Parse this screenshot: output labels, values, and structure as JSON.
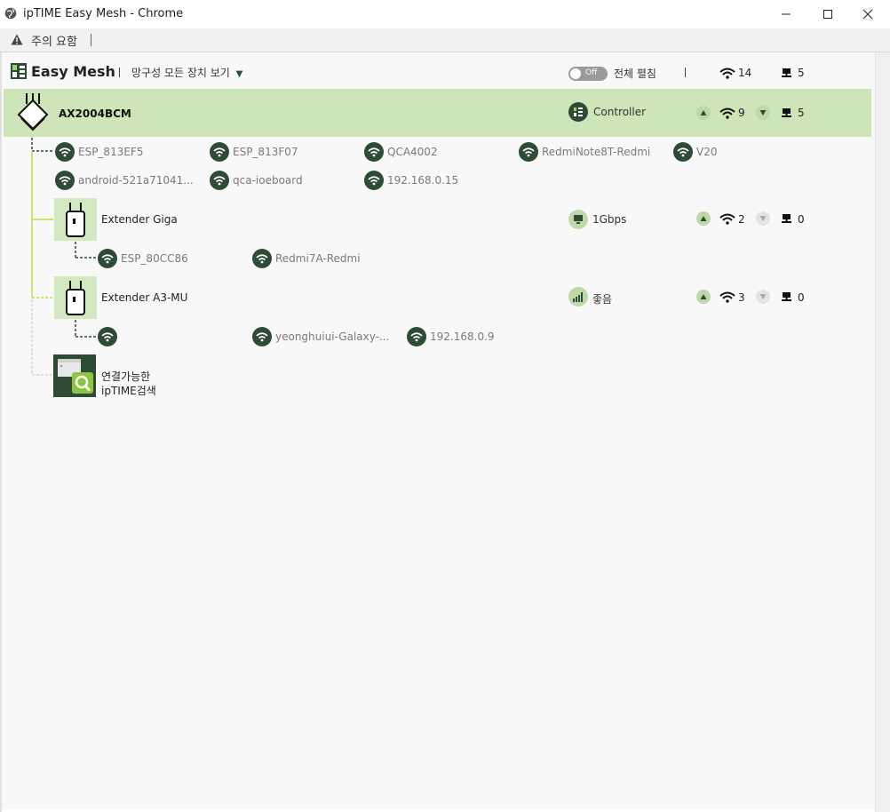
{
  "window": {
    "title": "ipTIME Easy Mesh - Chrome"
  },
  "addressbar": {
    "warning": "주의 요함"
  },
  "header": {
    "app_title": "Easy Mesh",
    "view_all": "망구성 모든 장치 보기",
    "toggle_label": "Off",
    "expand_all": "전체 펼침",
    "wifi_count": "14",
    "wired_count": "5"
  },
  "controller": {
    "name": "AX2004BCM",
    "role": "Controller",
    "wifi_count": "9",
    "wired_count": "5",
    "clients_row1": [
      "ESP_813EF5",
      "ESP_813F07",
      "QCA4002",
      "RedmiNote8T-Redmi",
      "V20"
    ],
    "clients_row2": [
      "android-521a71041...",
      "qca-ioeboard",
      "192.168.0.15"
    ]
  },
  "extenders": [
    {
      "name": "Extender Giga",
      "link": "1Gbps",
      "wifi_count": "2",
      "wired_count": "0",
      "clients": [
        "ESP_80CC86",
        "Redmi7A-Redmi"
      ]
    },
    {
      "name": "Extender A3-MU",
      "link": "좋음",
      "wifi_count": "3",
      "wired_count": "0",
      "clients": [
        "",
        "yeonghuiui-Galaxy-...",
        "192.168.0.9"
      ]
    }
  ],
  "search": {
    "line1": "연결가능한",
    "line2": "ipTIME검색"
  },
  "colors": {
    "accent_dark": "#2e4b35",
    "accent_light": "#cee5b9",
    "line_yellow": "#c8d840"
  }
}
